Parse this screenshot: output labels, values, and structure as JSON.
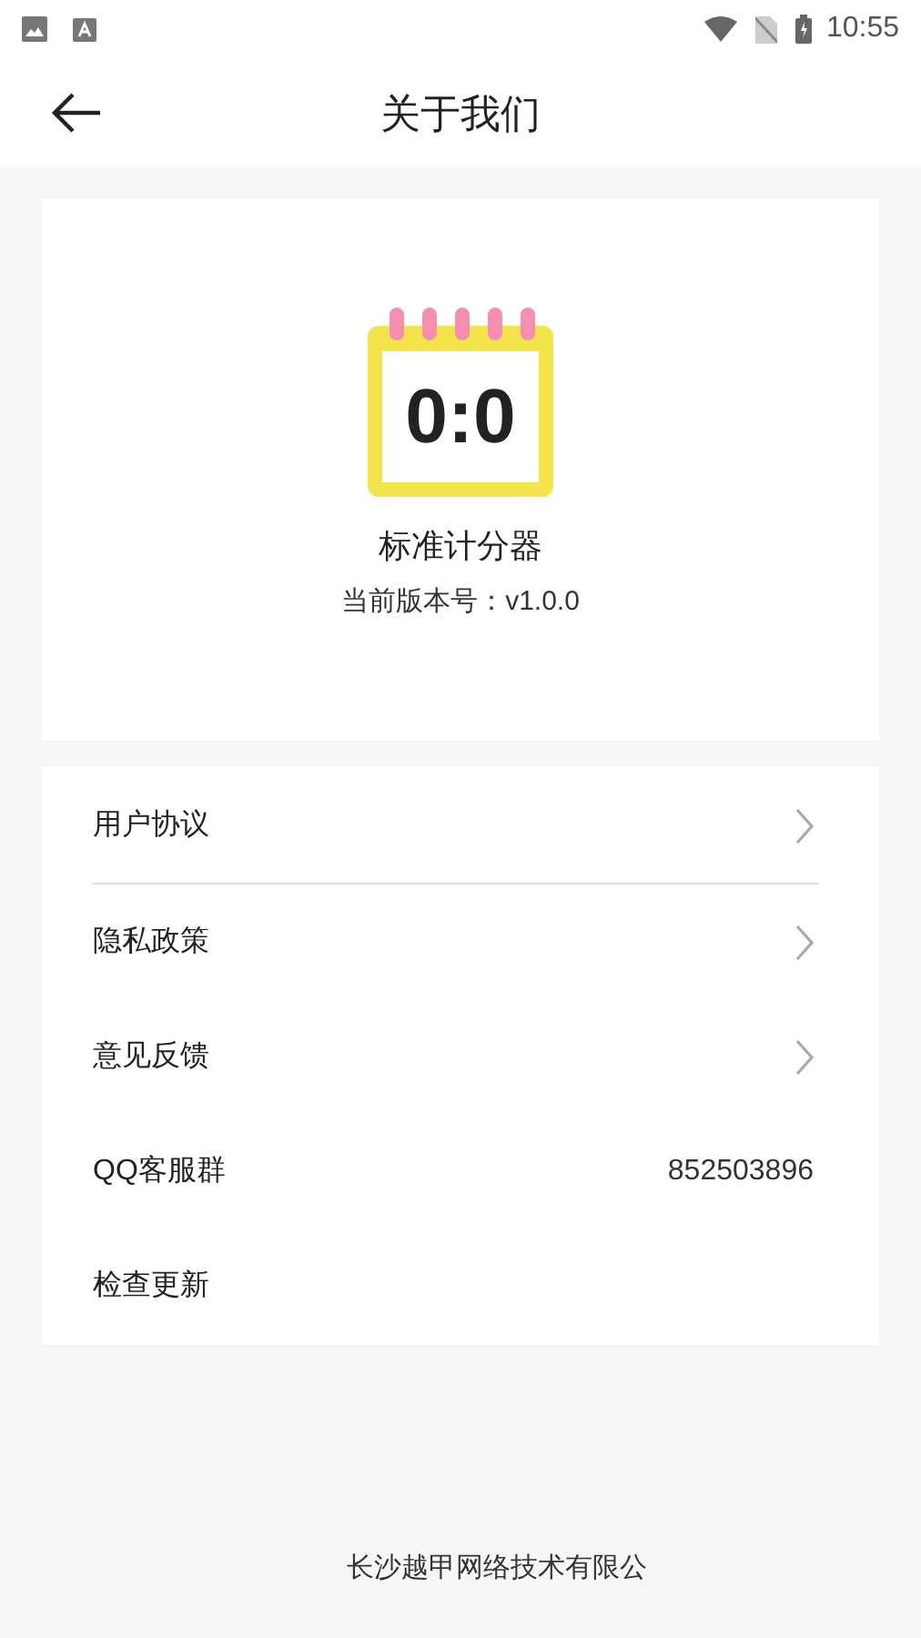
{
  "status_bar": {
    "time": "10:55"
  },
  "header": {
    "title": "关于我们"
  },
  "app": {
    "icon_text": "0:0",
    "name": "标准计分器",
    "version": "当前版本号：v1.0.0"
  },
  "menu": [
    {
      "kind": "link",
      "label": "用户协议",
      "divider": true
    },
    {
      "kind": "link",
      "label": "隐私政策",
      "divider": false
    },
    {
      "kind": "link",
      "label": "意见反馈",
      "divider": false
    },
    {
      "kind": "value",
      "label": "QQ客服群",
      "value": "852503896",
      "divider": false
    },
    {
      "kind": "plain",
      "label": "检查更新",
      "divider": false
    }
  ],
  "footer": {
    "company": "长沙越甲网络技术有限公"
  }
}
